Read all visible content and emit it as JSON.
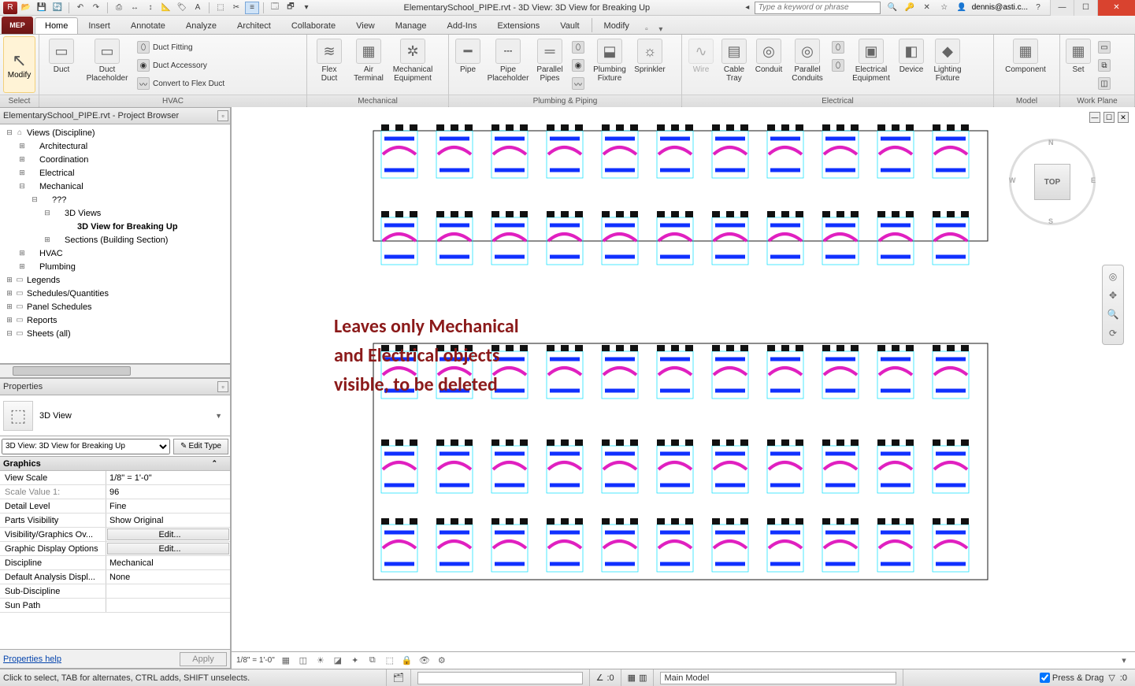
{
  "titlebar": {
    "title": "ElementarySchool_PIPE.rvt - 3D View: 3D View for Breaking Up",
    "search_placeholder": "Type a keyword or phrase",
    "user": "dennis@asti.c...",
    "qat_icons": [
      "app-menu",
      "open",
      "save",
      "sync",
      "undo",
      "redo",
      "print",
      "measure",
      "dim",
      "pin",
      "text",
      "3d",
      "section",
      "sheet",
      "filter",
      "sheet-view",
      "thin-lines",
      "close-hidden",
      "switch-win",
      "user-interface"
    ]
  },
  "tabs": {
    "app": "MEP",
    "items": [
      "Home",
      "Insert",
      "Annotate",
      "Analyze",
      "Architect",
      "Collaborate",
      "View",
      "Manage",
      "Add-Ins",
      "Extensions",
      "Vault",
      "Modify"
    ],
    "active": "Home"
  },
  "ribbon": {
    "modify": "Modify",
    "select": "Select",
    "groups": {
      "hvac": {
        "label": "HVAC",
        "big": [
          {
            "name": "duct",
            "label": "Duct",
            "icon": "▭"
          },
          {
            "name": "duct-placeholder",
            "label": "Duct\nPlaceholder",
            "icon": "▭"
          }
        ],
        "small": [
          {
            "name": "duct-fitting",
            "label": "Duct Fitting"
          },
          {
            "name": "duct-accessory",
            "label": "Duct Accessory"
          },
          {
            "name": "convert-flex",
            "label": "Convert to Flex Duct"
          }
        ]
      },
      "mech": {
        "label": "Mechanical",
        "big": [
          {
            "name": "flex-duct",
            "label": "Flex\nDuct",
            "icon": "≋"
          },
          {
            "name": "air-terminal",
            "label": "Air\nTerminal",
            "icon": "▦"
          },
          {
            "name": "mech-equip",
            "label": "Mechanical\nEquipment",
            "icon": "✲"
          }
        ]
      },
      "plumb": {
        "label": "Plumbing & Piping",
        "big": [
          {
            "name": "pipe",
            "label": "Pipe",
            "icon": "━"
          },
          {
            "name": "pipe-placeholder",
            "label": "Pipe\nPlaceholder",
            "icon": "┄"
          },
          {
            "name": "parallel-pipes",
            "label": "Parallel\nPipes",
            "icon": "═"
          },
          {
            "name": "plumbing-fixture",
            "label": "Plumbing\nFixture",
            "icon": "⬓"
          },
          {
            "name": "sprinkler",
            "label": "Sprinkler",
            "icon": "☼"
          }
        ],
        "small": [
          {
            "name": "pipe-fitting",
            "label": ""
          },
          {
            "name": "pipe-accessory",
            "label": ""
          },
          {
            "name": "flex-pipe",
            "label": ""
          }
        ]
      },
      "elec": {
        "label": "Electrical",
        "big": [
          {
            "name": "wire",
            "label": "Wire",
            "icon": "∿",
            "disabled": true
          },
          {
            "name": "cable-tray",
            "label": "Cable\nTray",
            "icon": "▤"
          },
          {
            "name": "conduit",
            "label": "Conduit",
            "icon": "◎"
          },
          {
            "name": "parallel-conduits",
            "label": "Parallel\nConduits",
            "icon": "◎"
          },
          {
            "name": "electrical-equipment",
            "label": "Electrical\nEquipment",
            "icon": "▣"
          },
          {
            "name": "device",
            "label": "Device",
            "icon": "◧"
          },
          {
            "name": "lighting-fixture",
            "label": "Lighting\nFixture",
            "icon": "◆"
          }
        ],
        "small": [
          {
            "name": "cable-tray-fitting",
            "label": ""
          },
          {
            "name": "conduit-fitting",
            "label": ""
          }
        ]
      },
      "model": {
        "label": "Model",
        "big": [
          {
            "name": "component",
            "label": "Component",
            "icon": "▦"
          }
        ]
      },
      "work": {
        "label": "Work Plane",
        "big": [
          {
            "name": "set",
            "label": "Set",
            "icon": "▦"
          }
        ],
        "small": [
          {
            "name": "show",
            "label": ""
          },
          {
            "name": "ref-plane",
            "label": ""
          },
          {
            "name": "viewer",
            "label": ""
          }
        ]
      }
    }
  },
  "browser": {
    "title": "ElementarySchool_PIPE.rvt - Project Browser",
    "nodes": [
      {
        "d": 0,
        "exp": "-",
        "ico": "⌂",
        "label": "Views (Discipline)"
      },
      {
        "d": 1,
        "exp": "+",
        "ico": "",
        "label": "Architectural"
      },
      {
        "d": 1,
        "exp": "+",
        "ico": "",
        "label": "Coordination"
      },
      {
        "d": 1,
        "exp": "+",
        "ico": "",
        "label": "Electrical"
      },
      {
        "d": 1,
        "exp": "-",
        "ico": "",
        "label": "Mechanical"
      },
      {
        "d": 2,
        "exp": "-",
        "ico": "",
        "label": "???"
      },
      {
        "d": 3,
        "exp": "-",
        "ico": "",
        "label": "3D Views"
      },
      {
        "d": 4,
        "exp": "",
        "ico": "",
        "label": "3D View for Breaking Up",
        "sel": true
      },
      {
        "d": 3,
        "exp": "+",
        "ico": "",
        "label": "Sections (Building Section)"
      },
      {
        "d": 1,
        "exp": "+",
        "ico": "",
        "label": "HVAC"
      },
      {
        "d": 1,
        "exp": "+",
        "ico": "",
        "label": "Plumbing"
      },
      {
        "d": 0,
        "exp": "+",
        "ico": "▭",
        "label": "Legends"
      },
      {
        "d": 0,
        "exp": "+",
        "ico": "▭",
        "label": "Schedules/Quantities"
      },
      {
        "d": 0,
        "exp": "+",
        "ico": "▭",
        "label": "Panel Schedules"
      },
      {
        "d": 0,
        "exp": "+",
        "ico": "▭",
        "label": "Reports"
      },
      {
        "d": 0,
        "exp": "-",
        "ico": "▭",
        "label": "Sheets (all)"
      }
    ]
  },
  "properties": {
    "title": "Properties",
    "type_name": "3D View",
    "instance": "3D View: 3D View for Breaking Up",
    "edit_type": "Edit Type",
    "group": "Graphics",
    "rows": [
      {
        "k": "View Scale",
        "v": "1/8\" = 1'-0\""
      },
      {
        "k": "Scale Value    1:",
        "v": "96",
        "gray": true
      },
      {
        "k": "Detail Level",
        "v": "Fine"
      },
      {
        "k": "Parts Visibility",
        "v": "Show Original"
      },
      {
        "k": "Visibility/Graphics Ov...",
        "v": "Edit...",
        "btn": true
      },
      {
        "k": "Graphic Display Options",
        "v": "Edit...",
        "btn": true
      },
      {
        "k": "Discipline",
        "v": "Mechanical"
      },
      {
        "k": "Default Analysis Displ...",
        "v": "None"
      },
      {
        "k": "Sub-Discipline",
        "v": ""
      },
      {
        "k": "Sun Path",
        "v": ""
      }
    ],
    "help": "Properties help",
    "apply": "Apply"
  },
  "canvas": {
    "viewcube": {
      "face": "TOP",
      "N": "N",
      "S": "S",
      "E": "E",
      "W": "W"
    },
    "annotation": "Leaves only Mechanical\nand Electrical objects\nvisible, to be deleted",
    "viewbar_scale": "1/8\" = 1'-0\""
  },
  "status": {
    "hint": "Click to select, TAB for alternates, CTRL adds, SHIFT unselects.",
    "angle": ":0",
    "mainmodel": "Main Model",
    "pressdrag": "Press & Drag",
    "filter": ":0"
  }
}
